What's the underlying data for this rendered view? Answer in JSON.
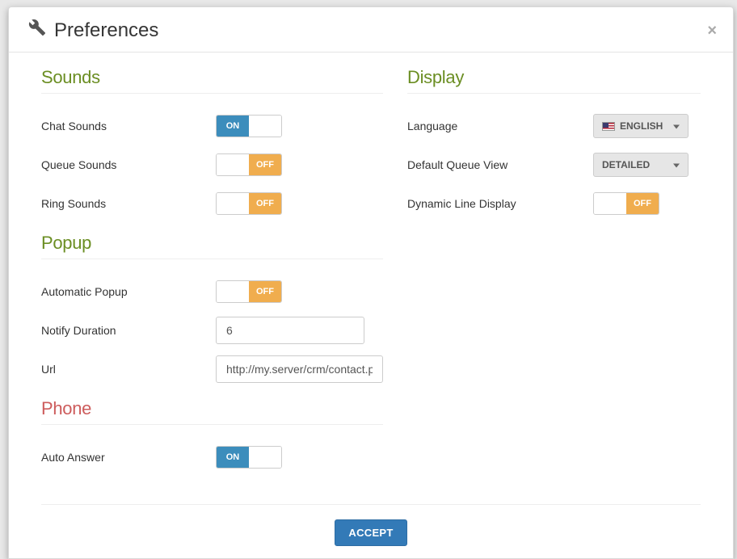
{
  "header": {
    "title": "Preferences"
  },
  "sounds": {
    "heading": "Sounds",
    "chat": {
      "label": "Chat Sounds",
      "state": "on",
      "text": "ON"
    },
    "queue": {
      "label": "Queue Sounds",
      "state": "off",
      "text": "OFF"
    },
    "ring": {
      "label": "Ring Sounds",
      "state": "off",
      "text": "OFF"
    }
  },
  "popup": {
    "heading": "Popup",
    "automatic": {
      "label": "Automatic Popup",
      "state": "off",
      "text": "OFF"
    },
    "notify": {
      "label": "Notify Duration",
      "value": "6"
    },
    "url": {
      "label": "Url",
      "value": "http://my.server/crm/contact.php?phone=#{CLIDNUM}"
    }
  },
  "phone": {
    "heading": "Phone",
    "autoAnswer": {
      "label": "Auto Answer",
      "state": "on",
      "text": "ON"
    }
  },
  "display": {
    "heading": "Display",
    "language": {
      "label": "Language",
      "value": "ENGLISH"
    },
    "defaultQueue": {
      "label": "Default Queue View",
      "value": "DETAILED"
    },
    "dynamicLine": {
      "label": "Dynamic Line Display",
      "state": "off",
      "text": "OFF"
    }
  },
  "footer": {
    "accept": "ACCEPT"
  }
}
